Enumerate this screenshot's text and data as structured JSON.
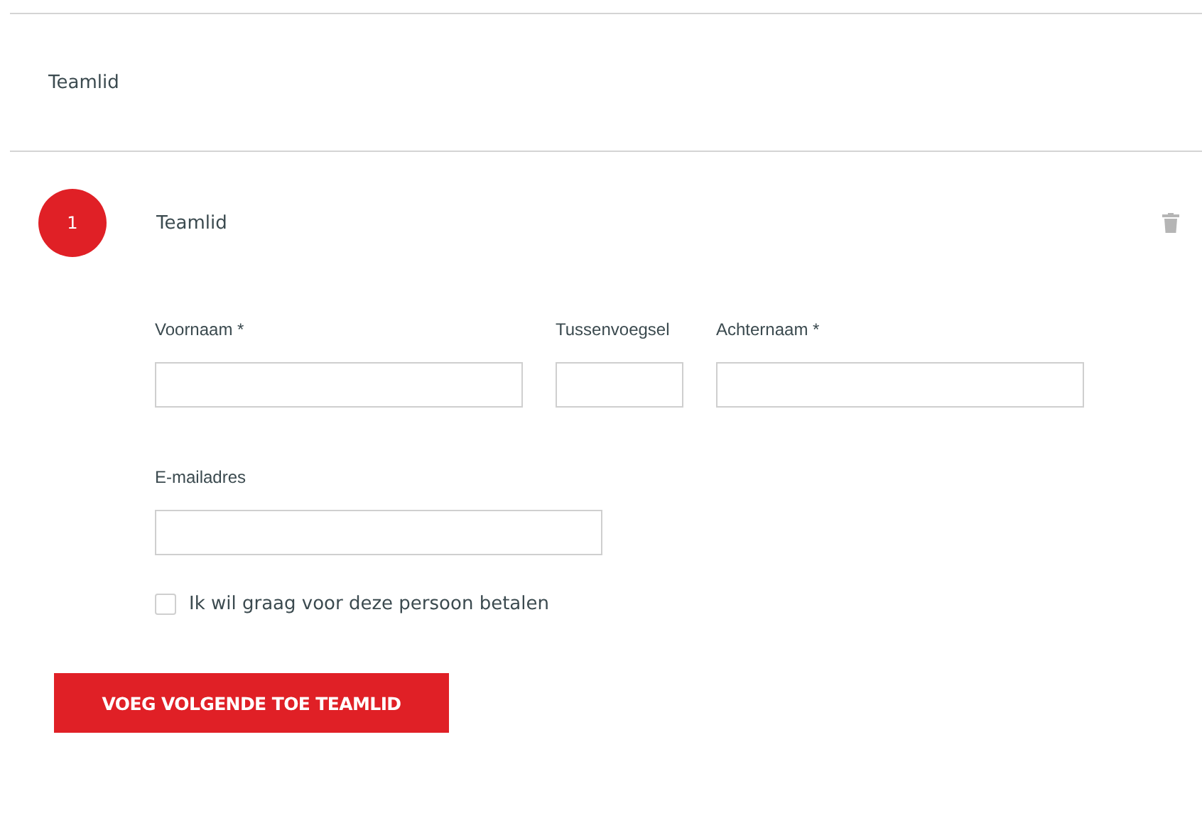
{
  "section_title": "Teamlid",
  "member": {
    "number": "1",
    "title": "Teamlid"
  },
  "name_fields": [
    {
      "label": "Voornaam *"
    },
    {
      "label": "Tussenvoegsel"
    },
    {
      "label": "Achternaam *"
    }
  ],
  "email_field": {
    "label": "E-mailadres"
  },
  "pay_checkbox": {
    "label": "Ik wil graag voor deze persoon betalen",
    "checked": false
  },
  "add_button": "VOEG VOLGENDE TOE TEAMLID"
}
